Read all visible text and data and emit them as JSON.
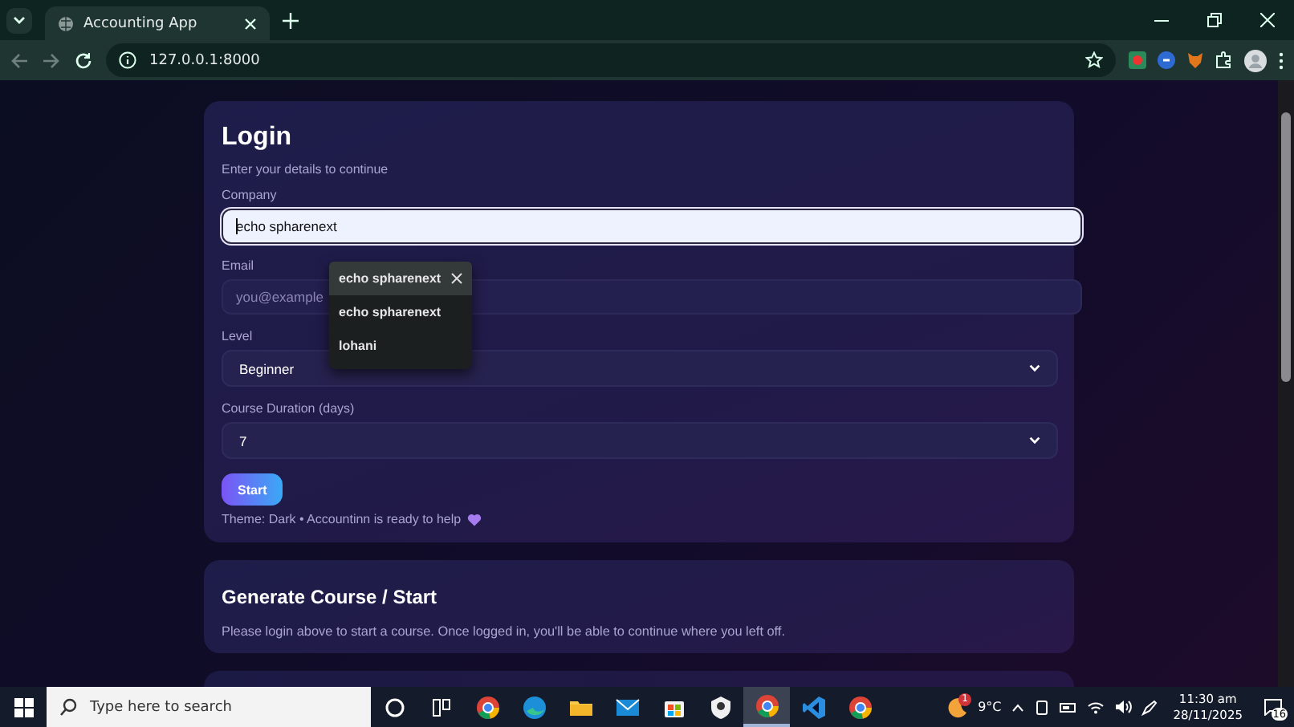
{
  "browser": {
    "tabs": [
      {
        "title": "Accounting App",
        "selected": true
      }
    ],
    "address": "127.0.0.1:8000"
  },
  "login": {
    "title": "Login",
    "subtitle": "Enter your details to continue",
    "fields": [
      {
        "kind": "text",
        "label": "Company",
        "value": "echo spharenext",
        "focused": true
      },
      {
        "kind": "text",
        "label": "Email",
        "placeholder": "you@example",
        "focused": false
      },
      {
        "kind": "select",
        "label": "Level",
        "value": "Beginner"
      },
      {
        "kind": "select",
        "label": "Course Duration (days)",
        "value": "7"
      }
    ],
    "autocomplete": [
      {
        "text": "echo spharenext",
        "highlighted": true
      },
      {
        "text": "echo spharenext",
        "highlighted": false
      },
      {
        "text": "lohani",
        "highlighted": false
      }
    ],
    "button": "Start",
    "footer": "Theme: Dark • Accountinn is ready to help"
  },
  "course_card": {
    "title": "Generate Course / Start",
    "text": "Please login above to start a course. Once logged in, you'll be able to continue where you left off."
  },
  "taskbar": {
    "search_placeholder": "Type here to search",
    "apps": [
      {
        "kind": "cortana",
        "active": false
      },
      {
        "kind": "taskview",
        "active": false
      },
      {
        "kind": "chrome",
        "active": false
      },
      {
        "kind": "edge",
        "active": false
      },
      {
        "kind": "folder",
        "active": false
      },
      {
        "kind": "mail",
        "active": false
      },
      {
        "kind": "store",
        "active": false
      },
      {
        "kind": "app",
        "active": false
      },
      {
        "kind": "chrome",
        "active": true
      },
      {
        "kind": "code",
        "active": false
      },
      {
        "kind": "chrome",
        "active": false
      }
    ],
    "weather": {
      "badge": "1",
      "temperature": "9°C"
    },
    "time": "11:30 am",
    "date": "28/11/2025",
    "notifications": "16"
  }
}
